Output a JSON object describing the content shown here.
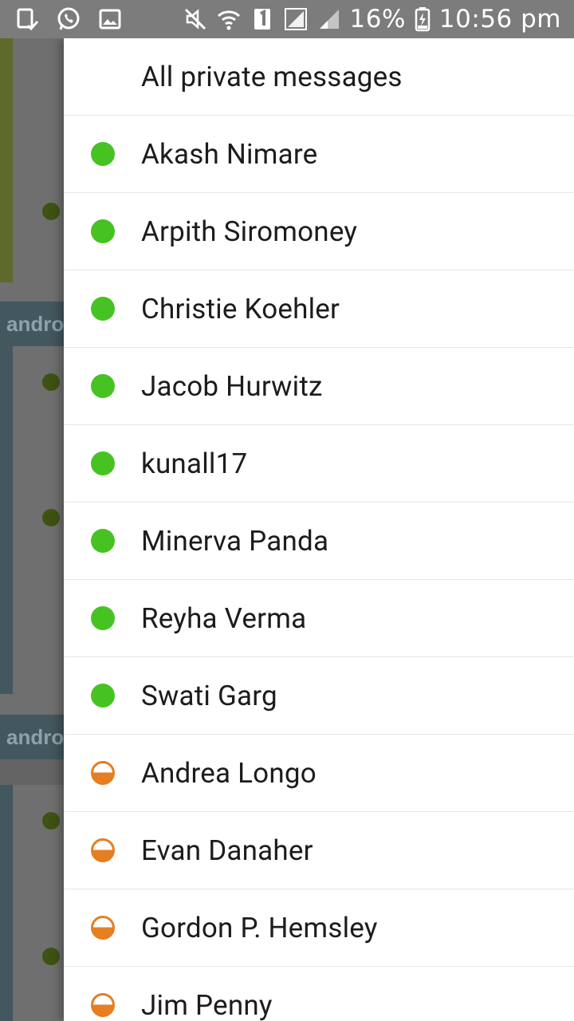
{
  "status_bar": {
    "left_icons": [
      "screenshot-icon",
      "whatsapp-icon",
      "gallery-icon"
    ],
    "right_icons": [
      "mute-icon",
      "wifi-icon",
      "sim1-icon",
      "signal-icon",
      "signal2-icon",
      "battery-charging-icon"
    ],
    "battery": "16%",
    "time": "10:56 pm"
  },
  "background": {
    "header_text": "andro"
  },
  "drawer": {
    "header": {
      "label": "All private messages"
    },
    "users": [
      {
        "name": "Akash Nimare",
        "status": "active"
      },
      {
        "name": "Arpith Siromoney",
        "status": "active"
      },
      {
        "name": "Christie Koehler",
        "status": "active"
      },
      {
        "name": "Jacob Hurwitz",
        "status": "active"
      },
      {
        "name": "kunall17",
        "status": "active"
      },
      {
        "name": "Minerva Panda",
        "status": "active"
      },
      {
        "name": "Reyha Verma",
        "status": "active"
      },
      {
        "name": "Swati Garg",
        "status": "active"
      },
      {
        "name": "Andrea Longo",
        "status": "idle"
      },
      {
        "name": "Evan Danaher",
        "status": "idle"
      },
      {
        "name": "Gordon P. Hemsley",
        "status": "idle"
      },
      {
        "name": "Jim Penny",
        "status": "idle"
      }
    ]
  },
  "colors": {
    "active": "#46c322",
    "idle": "#e67e22"
  }
}
